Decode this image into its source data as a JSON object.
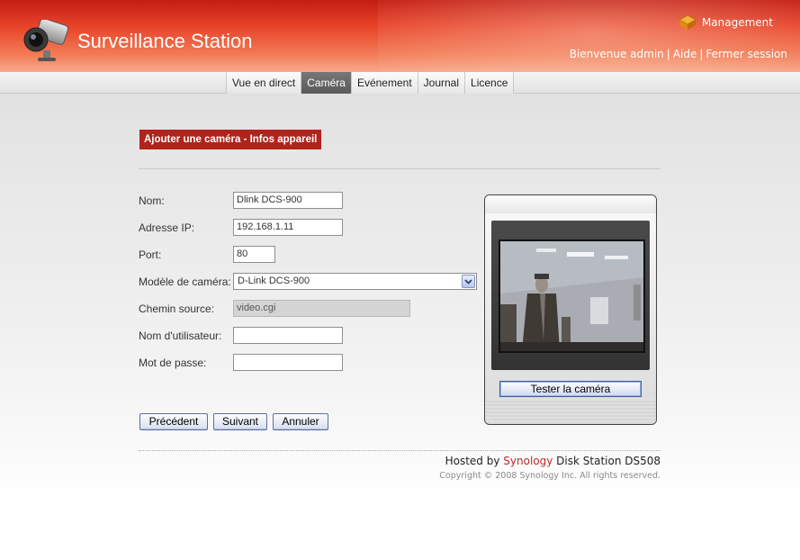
{
  "header": {
    "title": "Surveillance Station",
    "management_label": "Management",
    "welcome": "Bienvenue admin",
    "help": "Aide",
    "logout": "Fermer session",
    "logo_icon": "camera-icon",
    "management_icon": "management-icon"
  },
  "tabs": [
    {
      "label": "Vue en direct",
      "active": false
    },
    {
      "label": "Caméra",
      "active": true
    },
    {
      "label": "Evénement",
      "active": false
    },
    {
      "label": "Journal",
      "active": false
    },
    {
      "label": "Licence",
      "active": false
    }
  ],
  "page": {
    "section_title": "Ajouter une caméra - Infos appareil"
  },
  "form": {
    "name_label": "Nom:",
    "name_value": "Dlink DCS-900",
    "ip_label": "Adresse IP:",
    "ip_value": "192.168.1.11",
    "port_label": "Port:",
    "port_value": "80",
    "model_label": "Modèle de caméra:",
    "model_value": "D-Link DCS-900",
    "source_label": "Chemin source:",
    "source_value": "video.cgi",
    "user_label": "Nom d'utilisateur:",
    "user_value": "",
    "password_label": "Mot de passe:",
    "password_value": ""
  },
  "buttons": {
    "previous": "Précédent",
    "next": "Suivant",
    "cancel": "Annuler",
    "test_camera": "Tester la caméra"
  },
  "footer": {
    "hosted_prefix": "Hosted by",
    "brand": "Synology",
    "hosted_suffix": "Disk Station DS508",
    "copyright": "Copyright © 2008 Synology Inc. All rights reserved."
  },
  "colors": {
    "header_red": "#c41d13",
    "section_title_bg": "#b0241c",
    "brand_red": "#c0282b",
    "active_tab": "#666666"
  }
}
